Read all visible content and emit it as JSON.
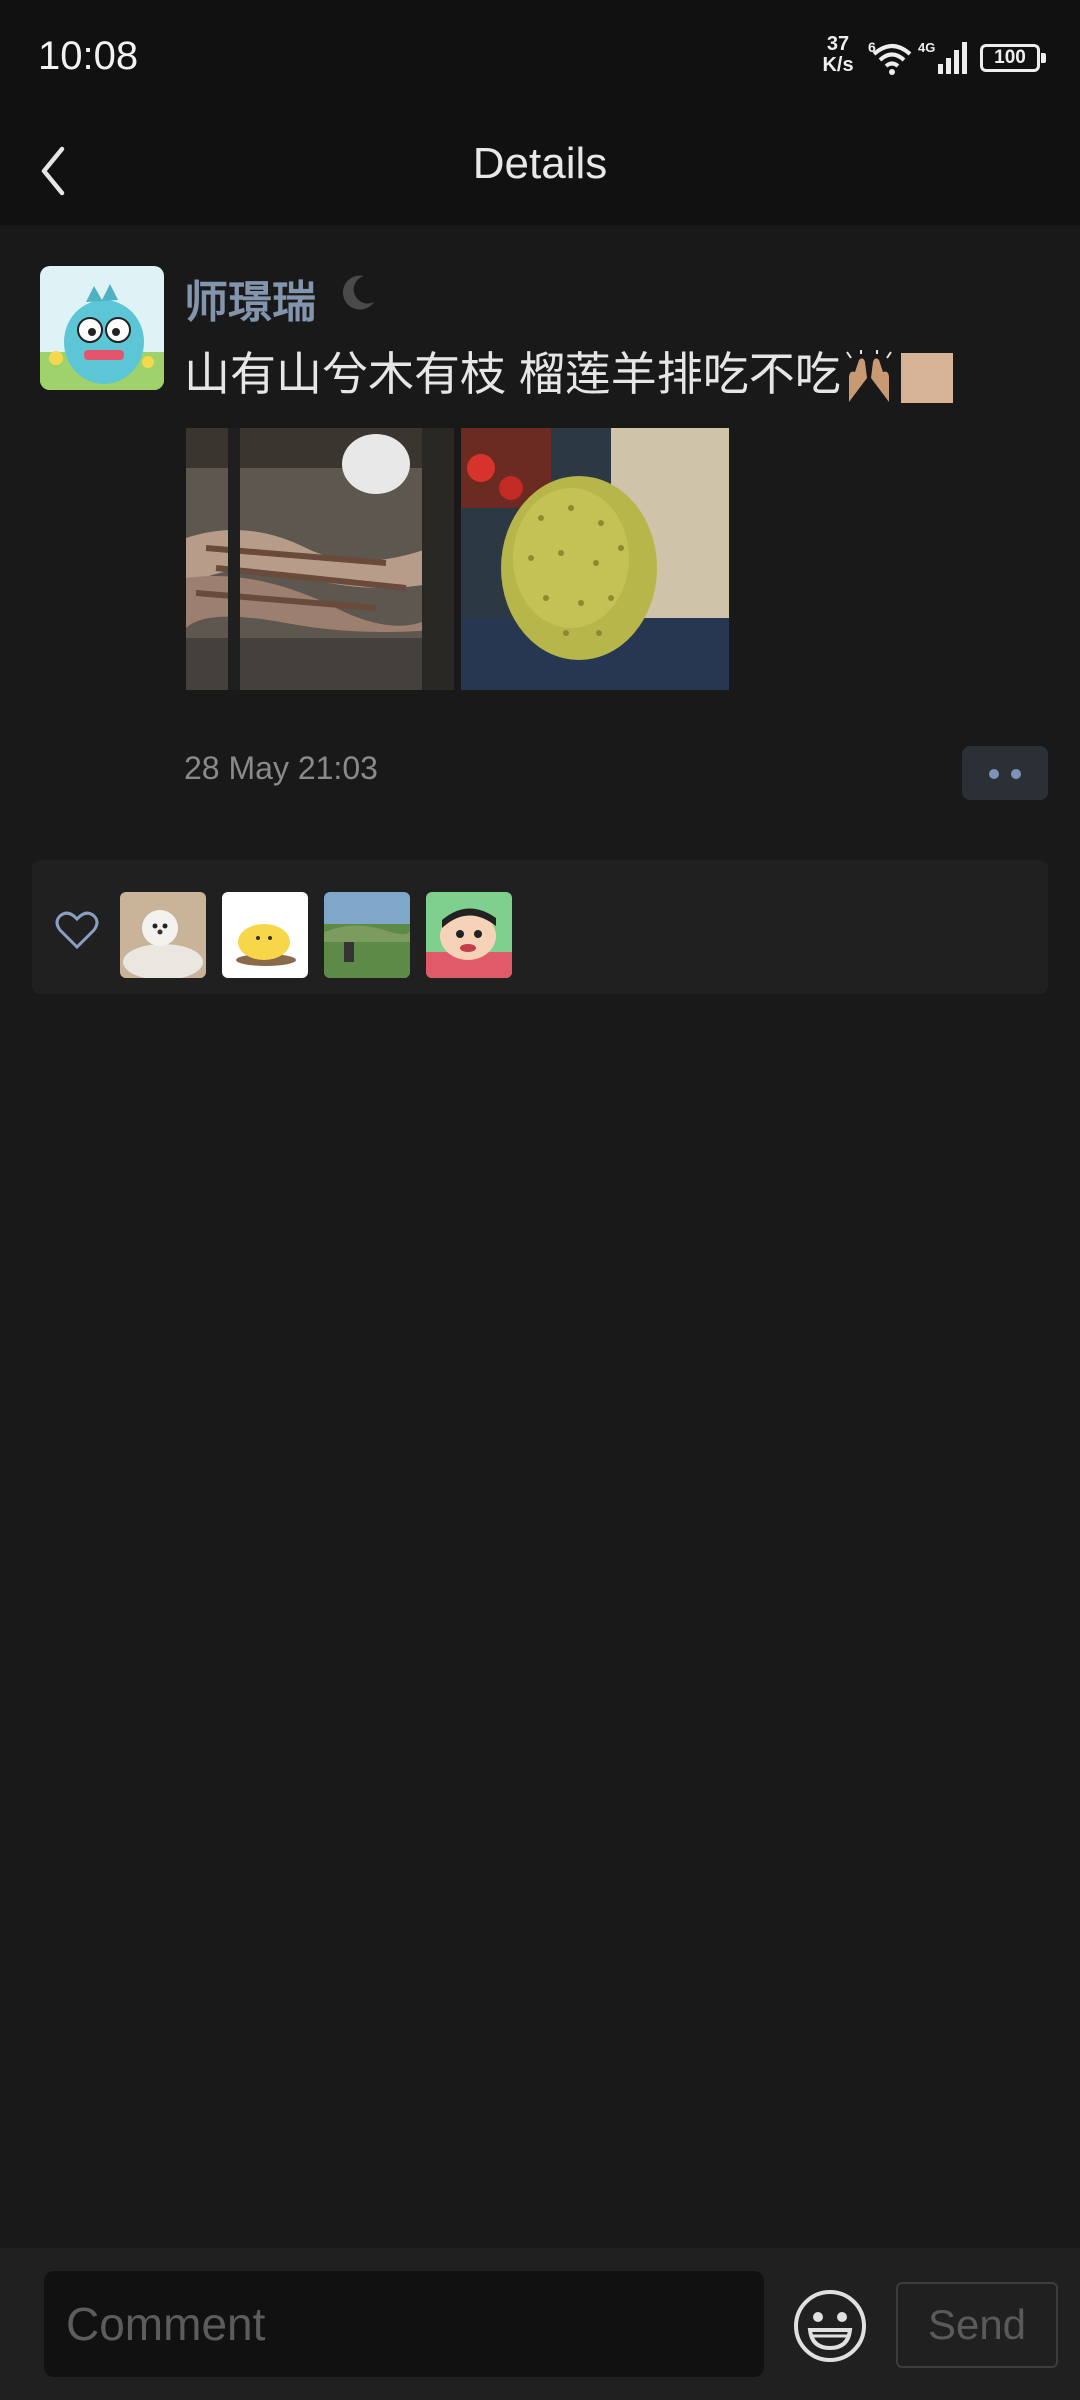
{
  "status_bar": {
    "time": "10:08",
    "net_speed": "37",
    "net_unit": "K/s",
    "wifi_badge": "6",
    "network_type": "4G",
    "battery": "100"
  },
  "header": {
    "title": "Details"
  },
  "post": {
    "username": "师璟瑞",
    "text": "山有山兮木有枝 榴莲羊排吃不吃",
    "images": [
      {
        "icon": "grilled-lamb-chops-photo"
      },
      {
        "icon": "durian-on-scale-photo"
      }
    ],
    "timestamp": "28 May 21:03"
  },
  "likes": {
    "icon": "heart-icon",
    "count_shown": 4
  },
  "composer": {
    "placeholder": "Comment",
    "send_label": "Send"
  },
  "colors": {
    "background": "#191919",
    "bar": "#111111",
    "username": "#8394ad",
    "accent_dots": "#7e93b5"
  }
}
